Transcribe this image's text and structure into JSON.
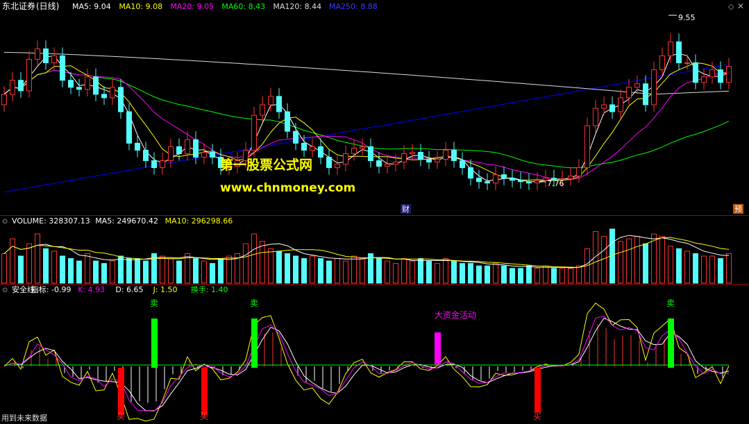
{
  "colors": {
    "up": "#ff3232",
    "down": "#54fcfc",
    "ma5": "#ffffff",
    "ma10": "#ffff00",
    "ma20": "#ff00ff",
    "ma60": "#00ff00",
    "ma120": "#dcdcdc",
    "ma250": "#0000ff",
    "divider": "#b00000",
    "buy": "#ff0000",
    "sell": "#00ff00",
    "fund": "#ff00ff"
  },
  "main": {
    "stock": "东北证券",
    "period": "(日线)",
    "legend": [
      {
        "label": "MA5: 9.04",
        "color": "#ffffff"
      },
      {
        "label": "MA10: 9.08",
        "color": "#ffff00"
      },
      {
        "label": "MA20: 9.05",
        "color": "#ff00ff"
      },
      {
        "label": "MA60: 8.43",
        "color": "#00ff00"
      },
      {
        "label": "MA120: 8.44",
        "color": "#dcdcdc"
      },
      {
        "label": "MA250: 8.88",
        "color": "#3a3aff"
      }
    ],
    "high_label": "9.55",
    "low_label": "7.76",
    "watermark_title": "第一股票公式网",
    "watermark_url": "www.chnmoney.com",
    "marker_cai": "财",
    "marker_yu": "预"
  },
  "volume": {
    "legend": [
      {
        "label": "VOLUME: 328307.13",
        "color": "#ffffff"
      },
      {
        "label": "MA5: 249670.42",
        "color": "#ffffff"
      },
      {
        "label": "MA10: 296298.66",
        "color": "#ffff00"
      }
    ]
  },
  "indicator": {
    "legend": [
      {
        "label": "安全线",
        "color": "#ffffff"
      },
      {
        "label": "指标: -0.99",
        "color": "#ffffff"
      },
      {
        "label": "K: 4.93",
        "color": "#ff00ff"
      },
      {
        "label": "D: 6.65",
        "color": "#ffffff"
      },
      {
        "label": "J: 1.50",
        "color": "#ffff00"
      },
      {
        "label": "换手: 1.40",
        "color": "#00ff00"
      }
    ],
    "sell_label": "卖",
    "buy_label": "买",
    "fund_label": "大资金活动"
  },
  "footer": {
    "note": "用到未来数据"
  },
  "chart_data": {
    "type": "candlestick",
    "n": 88,
    "ylim": [
      7.2,
      9.9
    ],
    "close": [
      8.75,
      8.95,
      8.8,
      9.25,
      9.4,
      9.2,
      9.3,
      8.95,
      8.85,
      8.82,
      9.0,
      8.75,
      8.7,
      8.85,
      8.5,
      8.05,
      7.95,
      7.8,
      7.7,
      7.8,
      8.0,
      7.9,
      8.1,
      7.85,
      7.92,
      7.85,
      7.7,
      7.72,
      7.8,
      7.95,
      8.45,
      8.6,
      8.72,
      8.5,
      8.22,
      8.05,
      7.95,
      8.0,
      7.85,
      7.7,
      7.75,
      7.9,
      7.98,
      8.0,
      7.8,
      7.72,
      7.75,
      7.78,
      7.9,
      7.92,
      7.82,
      7.78,
      7.82,
      7.95,
      7.8,
      7.7,
      7.55,
      7.5,
      7.48,
      7.6,
      7.55,
      7.52,
      7.5,
      7.48,
      7.52,
      7.55,
      7.53,
      7.54,
      7.58,
      7.7,
      8.3,
      8.55,
      8.6,
      8.5,
      8.7,
      8.85,
      8.9,
      8.6,
      9.1,
      9.3,
      9.5,
      9.2,
      9.2,
      8.92,
      9.0,
      9.1,
      8.92,
      9.15
    ],
    "open": [
      8.6,
      8.75,
      8.95,
      8.8,
      9.25,
      9.4,
      9.2,
      9.3,
      8.95,
      8.85,
      8.82,
      9.0,
      8.75,
      8.7,
      8.85,
      8.5,
      8.05,
      7.95,
      7.8,
      7.7,
      7.8,
      8.0,
      7.9,
      8.1,
      7.85,
      7.92,
      7.85,
      7.7,
      7.72,
      7.8,
      7.95,
      8.45,
      8.6,
      8.72,
      8.5,
      8.22,
      8.05,
      7.95,
      8.0,
      7.85,
      7.7,
      7.75,
      7.9,
      7.98,
      8.0,
      7.8,
      7.72,
      7.75,
      7.78,
      7.9,
      7.92,
      7.82,
      7.78,
      7.82,
      7.95,
      7.8,
      7.7,
      7.55,
      7.5,
      7.48,
      7.6,
      7.55,
      7.52,
      7.5,
      7.48,
      7.52,
      7.55,
      7.53,
      7.54,
      7.58,
      7.7,
      8.3,
      8.55,
      8.6,
      8.5,
      8.7,
      8.85,
      8.9,
      8.6,
      9.1,
      9.3,
      9.5,
      9.2,
      9.2,
      8.92,
      9.0,
      9.1,
      8.92
    ],
    "volume": [
      0.6,
      0.9,
      0.55,
      0.8,
      1.0,
      0.7,
      0.65,
      0.55,
      0.5,
      0.45,
      0.6,
      0.45,
      0.4,
      0.45,
      0.55,
      0.5,
      0.5,
      0.45,
      0.6,
      0.55,
      0.5,
      0.45,
      0.6,
      0.5,
      0.45,
      0.4,
      0.5,
      0.55,
      0.6,
      0.8,
      1.0,
      0.85,
      0.7,
      0.65,
      0.6,
      0.55,
      0.5,
      0.55,
      0.5,
      0.45,
      0.5,
      0.45,
      0.55,
      0.5,
      0.6,
      0.5,
      0.45,
      0.4,
      0.5,
      0.45,
      0.5,
      0.45,
      0.4,
      0.5,
      0.45,
      0.4,
      0.4,
      0.35,
      0.35,
      0.4,
      0.35,
      0.3,
      0.3,
      0.35,
      0.3,
      0.35,
      0.3,
      0.3,
      0.3,
      0.35,
      0.7,
      1.05,
      0.95,
      1.1,
      0.85,
      0.9,
      0.95,
      0.8,
      1.0,
      0.95,
      0.75,
      0.7,
      0.65,
      0.6,
      0.55,
      0.55,
      0.5,
      0.6
    ]
  }
}
